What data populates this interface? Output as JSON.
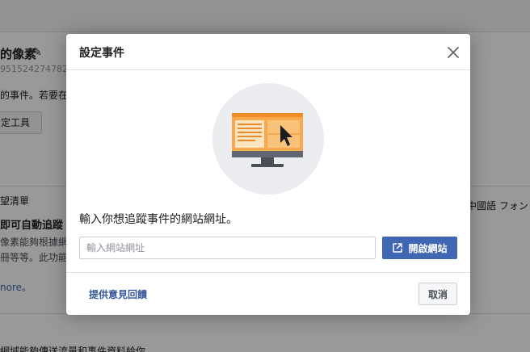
{
  "background": {
    "pixel_title": "的像素",
    "pixel_id": "951524274782",
    "line1": "的事件。若要在",
    "setup_button": "定工具",
    "wishlist": "望清單",
    "right_text": "中國語 フォント",
    "auto_heading": "即可自動追蹤",
    "desc1": "像素能夠根據網",
    "desc2": "冊等等。此功能",
    "more": "nore。",
    "bottom": "網域能夠傳送流量和事件資料給你。"
  },
  "modal": {
    "title": "設定事件",
    "prompt": "輸入你想追蹤事件的網站網址。",
    "url_placeholder": "輸入網站網址",
    "url_value": "",
    "open_button": "開啟網站",
    "feedback_link": "提供意見回饋",
    "cancel_button": "取消"
  },
  "icons": {
    "close": "close-icon",
    "external_link": "external-link-icon",
    "pencil": "pencil-icon",
    "illustration": "monitor-illustration"
  },
  "colors": {
    "primary": "#4267b2",
    "link": "#365899",
    "illustration_orange": "#f7a94b",
    "illustration_bg": "#ebedf0"
  }
}
